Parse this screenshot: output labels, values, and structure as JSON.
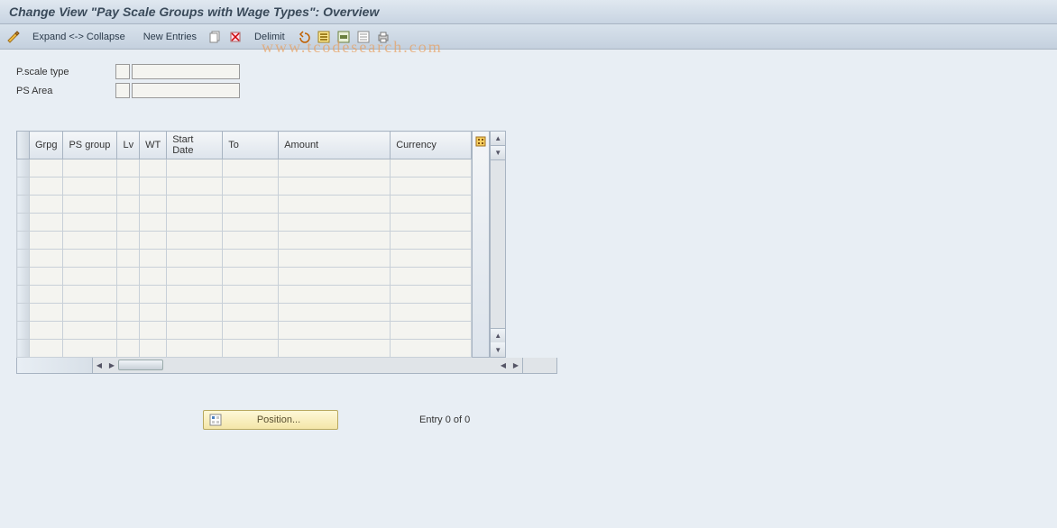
{
  "title": "Change View \"Pay Scale Groups with Wage Types\": Overview",
  "toolbar": {
    "expand_collapse": "Expand <-> Collapse",
    "new_entries": "New Entries",
    "delimit": "Delimit"
  },
  "watermark": "www.tcodesearch.com",
  "filters": {
    "pscale_type": {
      "label": "P.scale type",
      "code": "",
      "value": ""
    },
    "ps_area": {
      "label": "PS Area",
      "code": "",
      "value": ""
    }
  },
  "grid": {
    "columns": {
      "grpg": "Grpg",
      "psgroup": "PS group",
      "lv": "Lv",
      "wt": "WT",
      "start": "Start Date",
      "to": "To",
      "amount": "Amount",
      "currency": "Currency"
    },
    "rows": [
      {
        "grpg": "",
        "psgroup": "",
        "lv": "",
        "wt": "",
        "start": "",
        "to": "",
        "amount": "",
        "currency": ""
      },
      {
        "grpg": "",
        "psgroup": "",
        "lv": "",
        "wt": "",
        "start": "",
        "to": "",
        "amount": "",
        "currency": ""
      },
      {
        "grpg": "",
        "psgroup": "",
        "lv": "",
        "wt": "",
        "start": "",
        "to": "",
        "amount": "",
        "currency": ""
      },
      {
        "grpg": "",
        "psgroup": "",
        "lv": "",
        "wt": "",
        "start": "",
        "to": "",
        "amount": "",
        "currency": ""
      },
      {
        "grpg": "",
        "psgroup": "",
        "lv": "",
        "wt": "",
        "start": "",
        "to": "",
        "amount": "",
        "currency": ""
      },
      {
        "grpg": "",
        "psgroup": "",
        "lv": "",
        "wt": "",
        "start": "",
        "to": "",
        "amount": "",
        "currency": ""
      },
      {
        "grpg": "",
        "psgroup": "",
        "lv": "",
        "wt": "",
        "start": "",
        "to": "",
        "amount": "",
        "currency": ""
      },
      {
        "grpg": "",
        "psgroup": "",
        "lv": "",
        "wt": "",
        "start": "",
        "to": "",
        "amount": "",
        "currency": ""
      },
      {
        "grpg": "",
        "psgroup": "",
        "lv": "",
        "wt": "",
        "start": "",
        "to": "",
        "amount": "",
        "currency": ""
      },
      {
        "grpg": "",
        "psgroup": "",
        "lv": "",
        "wt": "",
        "start": "",
        "to": "",
        "amount": "",
        "currency": ""
      },
      {
        "grpg": "",
        "psgroup": "",
        "lv": "",
        "wt": "",
        "start": "",
        "to": "",
        "amount": "",
        "currency": ""
      }
    ]
  },
  "footer": {
    "position_label": "Position...",
    "entry_text": "Entry 0 of 0"
  }
}
